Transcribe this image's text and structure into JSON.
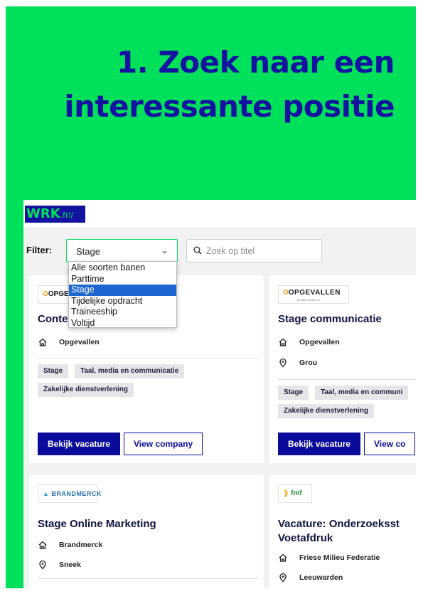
{
  "headline": {
    "line1": "1. Zoek naar een",
    "line2": "interessante positie"
  },
  "colors": {
    "brand_green": "#00e05a",
    "brand_navy": "#1313a0",
    "button_blue": "#0b0b9b",
    "dropdown_highlight": "#1e66d0"
  },
  "site": {
    "logo_main": "WRK",
    "logo_ext": ".frl/"
  },
  "filter": {
    "label": "Filter:",
    "selected": "Stage",
    "options": [
      "Alle soorten banen",
      "Parttime",
      "Stage",
      "Tijdelijke opdracht",
      "Traineeship",
      "Voltijd"
    ],
    "selected_index": 2
  },
  "search": {
    "placeholder": "Zoek op titel",
    "icon": "search-icon"
  },
  "cards": [
    {
      "logo": "OPGE",
      "title": "Conte",
      "company": "Opgevallen",
      "tags": [
        "Stage",
        "Taal, media en communicatie",
        "Zakelijke dienstverlening"
      ],
      "primary_button": "Bekijk vacature",
      "secondary_button": "View company"
    },
    {
      "logo": "OPGEVALLEN",
      "logo_sub": "het lijkt morgen.co",
      "title": "Stage communicatie",
      "company": "Opgevallen",
      "location": "Grou",
      "tags": [
        "Stage",
        "Taal, media en communi",
        "Zakelijke dienstverlening"
      ],
      "primary_button": "Bekijk vacature",
      "secondary_button": "View co"
    },
    {
      "logo": "BRANDMERCK",
      "title": "Stage Online Marketing",
      "company": "Brandmerck",
      "location": "Sneek"
    },
    {
      "logo": "fmf",
      "title_line1": "Vacature: Onderzoeksst",
      "title_line2": "Voetafdruk",
      "company": "Friese Milieu Federatie",
      "location": "Leeuwarden"
    }
  ]
}
